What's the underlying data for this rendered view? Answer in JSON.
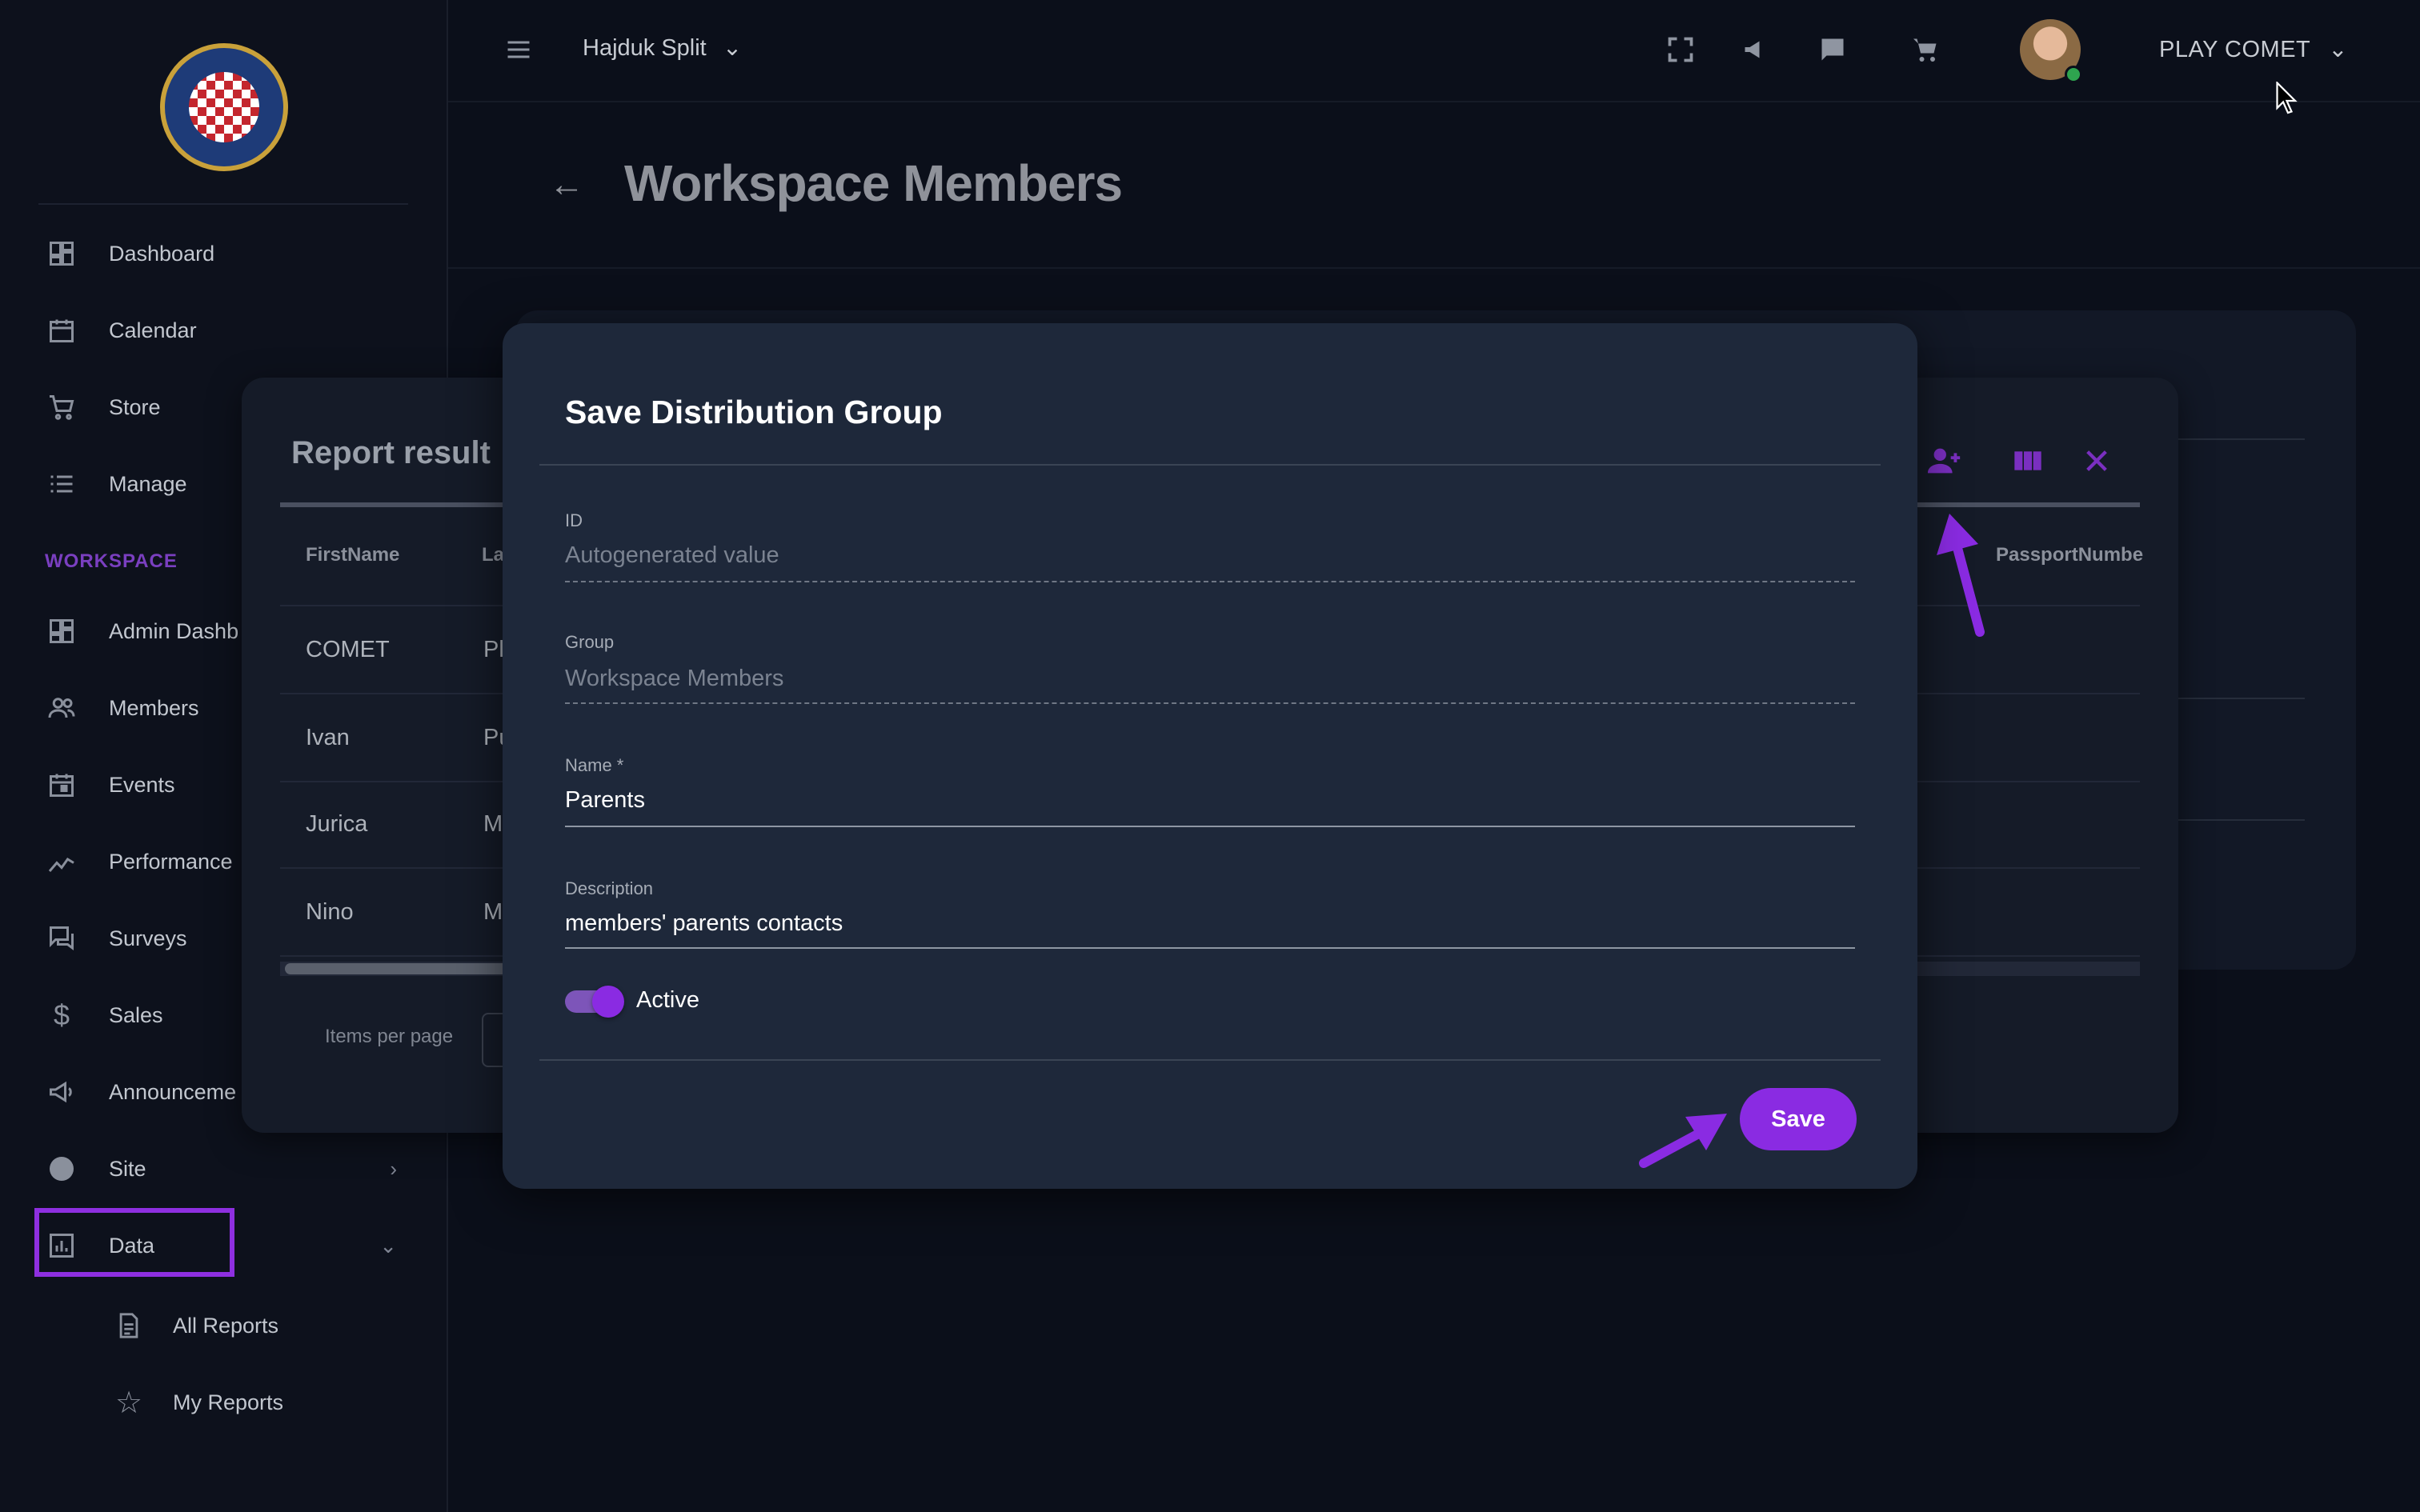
{
  "sidebar": {
    "items": [
      {
        "label": "Dashboard",
        "icon": "dashboard-icon"
      },
      {
        "label": "Calendar",
        "icon": "calendar-icon"
      },
      {
        "label": "Store",
        "icon": "cart-icon"
      },
      {
        "label": "Manage",
        "icon": "list-icon"
      }
    ],
    "section_label": "WORKSPACE",
    "workspace_items": [
      {
        "label": "Admin Dashb",
        "icon": "dashboard-icon"
      },
      {
        "label": "Members",
        "icon": "people-icon"
      },
      {
        "label": "Events",
        "icon": "calendar-icon"
      },
      {
        "label": "Performance",
        "icon": "trend-icon"
      },
      {
        "label": "Surveys",
        "icon": "chat-icon"
      },
      {
        "label": "Sales",
        "icon": "dollar-icon"
      },
      {
        "label": "Announceme",
        "icon": "megaphone-icon"
      },
      {
        "label": "Site",
        "icon": "globe-icon"
      },
      {
        "label": "Data",
        "icon": "chart-icon"
      }
    ],
    "data_sub_items": [
      {
        "label": "All Reports",
        "icon": "document-icon"
      },
      {
        "label": "My Reports",
        "icon": "star-icon"
      }
    ]
  },
  "header": {
    "club_name": "Hajduk Split",
    "user_name": "PLAY COMET"
  },
  "page": {
    "title": "Workspace Members"
  },
  "report": {
    "title": "Report result",
    "columns": [
      "FirstName",
      "La",
      "PassportNumbe"
    ],
    "rows": [
      {
        "first": "COMET",
        "last": "Pl"
      },
      {
        "first": "Ivan",
        "last": "Pu"
      },
      {
        "first": "Jurica",
        "last": "M"
      },
      {
        "first": "Nino",
        "last": "M"
      }
    ],
    "items_per_page_label": "Items per page"
  },
  "modal": {
    "title": "Save Distribution Group",
    "fields": {
      "id": {
        "label": "ID",
        "value": "Autogenerated value"
      },
      "group": {
        "label": "Group",
        "value": "Workspace Members"
      },
      "name": {
        "label": "Name *",
        "value": "Parents"
      },
      "description": {
        "label": "Description",
        "value": "members' parents contacts"
      }
    },
    "active_label": "Active",
    "active": true,
    "save_label": "Save"
  },
  "colors": {
    "accent": "#8a2be2",
    "background": "#0b0f1a",
    "modal_bg": "#1e283a"
  }
}
